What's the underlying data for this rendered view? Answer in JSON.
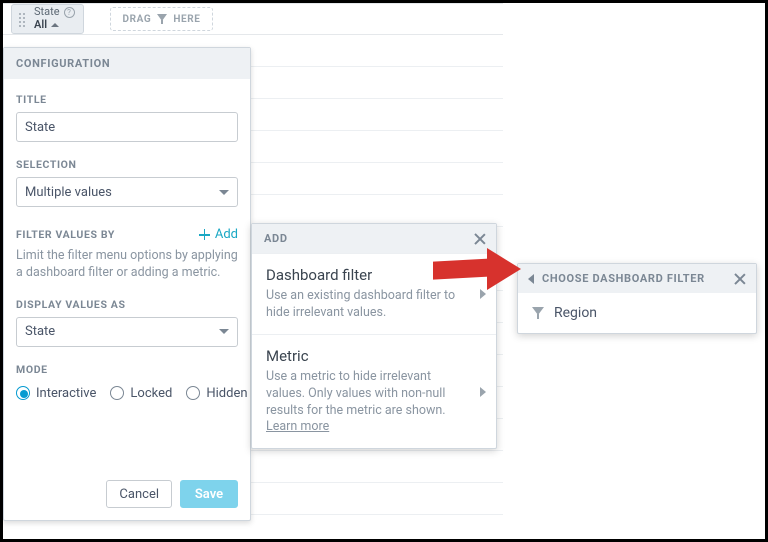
{
  "topbar": {
    "pill": {
      "label": "State",
      "value": "All"
    },
    "dropzone_left": "DRAG",
    "dropzone_right": "HERE"
  },
  "config": {
    "header": "CONFIGURATION",
    "title_label": "TITLE",
    "title_value": "State",
    "selection_label": "SELECTION",
    "selection_value": "Multiple values",
    "filterby_label": "FILTER VALUES BY",
    "add_link": "Add",
    "filterby_help": "Limit the filter menu options by applying a dashboard filter or adding a metric.",
    "display_label": "DISPLAY VALUES AS",
    "display_value": "State",
    "mode_label": "MODE",
    "modes": {
      "interactive": "Interactive",
      "locked": "Locked",
      "hidden": "Hidden"
    },
    "cancel": "Cancel",
    "save": "Save"
  },
  "addpop": {
    "header": "ADD",
    "opt1_title": "Dashboard filter",
    "opt1_desc": "Use an existing dashboard filter to hide irrelevant values.",
    "opt2_title": "Metric",
    "opt2_desc_a": "Use a metric to hide irrelevant values. Only values with non-null results for the metric are shown. ",
    "opt2_learn": "Learn more"
  },
  "choose": {
    "header": "CHOOSE DASHBOARD FILTER",
    "option": "Region"
  }
}
